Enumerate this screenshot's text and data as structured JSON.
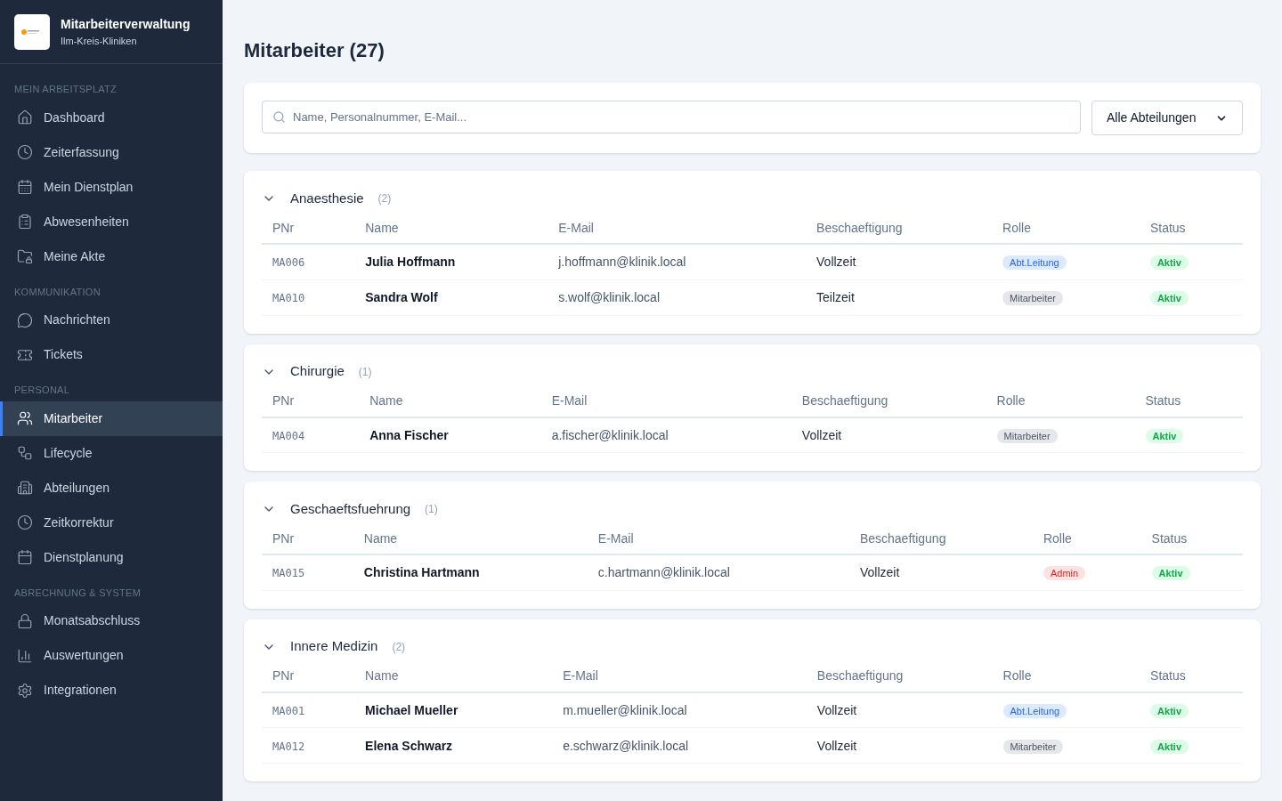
{
  "app": {
    "title": "Mitarbeiterverwaltung",
    "subtitle": "Ilm-Kreis-Kliniken"
  },
  "sidebar": {
    "groups": [
      {
        "heading": "MEIN ARBEITSPLATZ",
        "items": [
          {
            "label": "Dashboard",
            "selected": false
          },
          {
            "label": "Zeiterfassung",
            "selected": false
          },
          {
            "label": "Mein Dienstplan",
            "selected": false
          },
          {
            "label": "Abwesenheiten",
            "selected": false
          },
          {
            "label": "Meine Akte",
            "selected": false
          }
        ]
      },
      {
        "heading": "KOMMUNIKATION",
        "items": [
          {
            "label": "Nachrichten",
            "selected": false
          },
          {
            "label": "Tickets",
            "selected": false
          }
        ]
      },
      {
        "heading": "PERSONAL",
        "items": [
          {
            "label": "Mitarbeiter",
            "selected": true
          },
          {
            "label": "Lifecycle",
            "selected": false
          },
          {
            "label": "Abteilungen",
            "selected": false
          },
          {
            "label": "Zeitkorrektur",
            "selected": false
          },
          {
            "label": "Dienstplanung",
            "selected": false
          }
        ]
      },
      {
        "heading": "ABRECHNUNG & SYSTEM",
        "items": [
          {
            "label": "Monatsabschluss",
            "selected": false
          },
          {
            "label": "Auswertungen",
            "selected": false
          },
          {
            "label": "Integrationen",
            "selected": false
          }
        ]
      }
    ]
  },
  "page": {
    "title": "Mitarbeiter (27)"
  },
  "filters": {
    "search": {
      "placeholder": "Name, Personalnummer, E-Mail..."
    },
    "department": {
      "value": "Alle Abteilungen"
    }
  },
  "departments": [
    {
      "name": "Anaesthesie",
      "count": "(2)",
      "expanded": true,
      "columns": [
        "PNr",
        "Name",
        "E-Mail",
        "Beschaeftigung",
        "Rolle",
        "Status"
      ],
      "rows": [
        {
          "pnr": "MA006",
          "name": "Julia Hoffmann",
          "email": "j.hoffmann@klinik.local",
          "employment": "Vollzeit",
          "role": {
            "label": "Abt.Leitung",
            "kind": "lead"
          },
          "status": {
            "label": "Aktiv",
            "kind": "active"
          }
        },
        {
          "pnr": "MA010",
          "name": "Sandra Wolf",
          "email": "s.wolf@klinik.local",
          "employment": "Teilzeit",
          "role": {
            "label": "Mitarbeiter",
            "kind": "staff"
          },
          "status": {
            "label": "Aktiv",
            "kind": "active"
          }
        }
      ]
    },
    {
      "name": "Chirurgie",
      "count": "(1)",
      "expanded": true,
      "columns": [
        "PNr",
        "Name",
        "E-Mail",
        "Beschaeftigung",
        "Rolle",
        "Status"
      ],
      "rows": [
        {
          "pnr": "MA004",
          "name": "Anna Fischer",
          "email": "a.fischer@klinik.local",
          "employment": "Vollzeit",
          "role": {
            "label": "Mitarbeiter",
            "kind": "staff"
          },
          "status": {
            "label": "Aktiv",
            "kind": "active"
          }
        }
      ]
    },
    {
      "name": "Geschaeftsfuehrung",
      "count": "(1)",
      "expanded": true,
      "columns": [
        "PNr",
        "Name",
        "E-Mail",
        "Beschaeftigung",
        "Rolle",
        "Status"
      ],
      "rows": [
        {
          "pnr": "MA015",
          "name": "Christina Hartmann",
          "email": "c.hartmann@klinik.local",
          "employment": "Vollzeit",
          "role": {
            "label": "Admin",
            "kind": "admin"
          },
          "status": {
            "label": "Aktiv",
            "kind": "active"
          }
        }
      ]
    },
    {
      "name": "Innere Medizin",
      "count": "(2)",
      "expanded": true,
      "columns": [
        "PNr",
        "Name",
        "E-Mail",
        "Beschaeftigung",
        "Rolle",
        "Status"
      ],
      "rows": [
        {
          "pnr": "MA001",
          "name": "Michael Mueller",
          "email": "m.mueller@klinik.local",
          "employment": "Vollzeit",
          "role": {
            "label": "Abt.Leitung",
            "kind": "lead"
          },
          "status": {
            "label": "Aktiv",
            "kind": "active"
          }
        },
        {
          "pnr": "MA012",
          "name": "Elena Schwarz",
          "email": "e.schwarz@klinik.local",
          "employment": "Vollzeit",
          "role": {
            "label": "Mitarbeiter",
            "kind": "staff"
          },
          "status": {
            "label": "Aktiv",
            "kind": "active"
          }
        }
      ]
    }
  ]
}
